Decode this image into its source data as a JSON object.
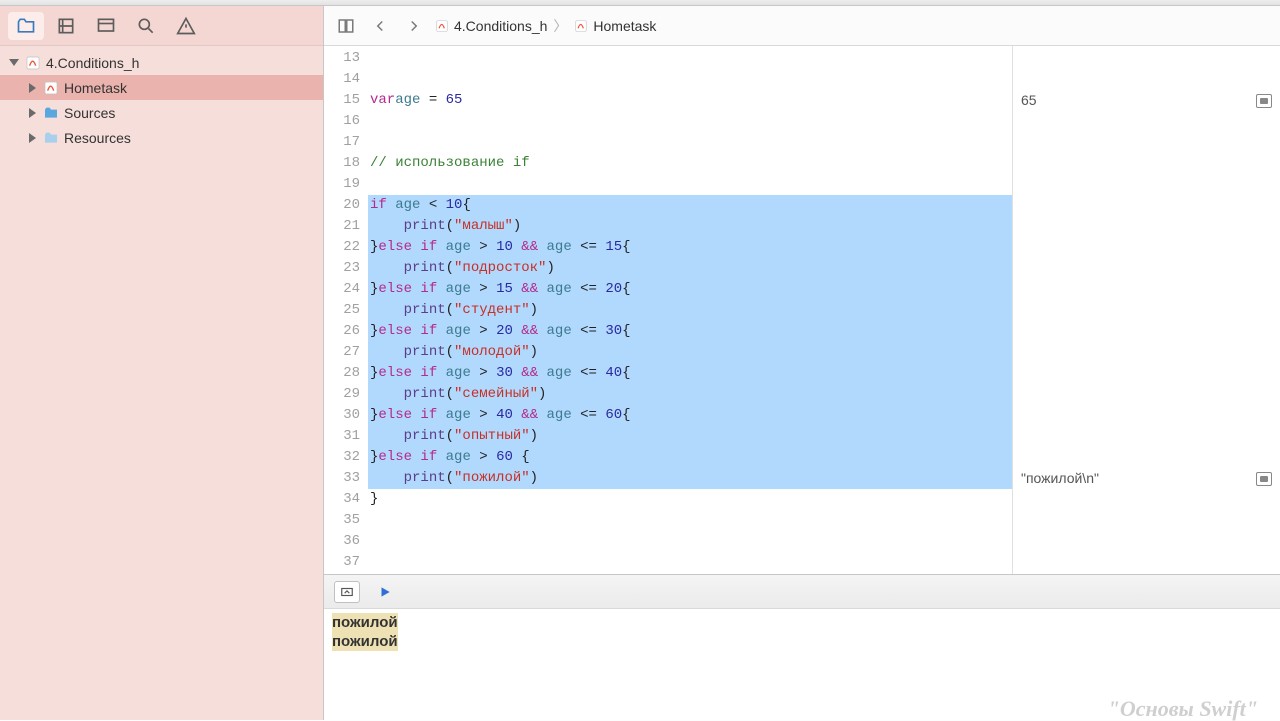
{
  "breadcrumb": {
    "project": "4.Conditions_h",
    "file": "Hometask"
  },
  "sidebar": {
    "root": "4.Conditions_h",
    "items": [
      {
        "label": "Hometask",
        "kind": "swift",
        "selected": true
      },
      {
        "label": "Sources",
        "kind": "folder-blue"
      },
      {
        "label": "Resources",
        "kind": "folder-lblue"
      }
    ]
  },
  "code": {
    "startLine": 13,
    "lines": [
      {
        "n": 13,
        "raw": ""
      },
      {
        "n": 14,
        "raw": ""
      },
      {
        "n": 15,
        "tokens": [
          [
            "kw",
            "var"
          ],
          [
            "",
            ""
          ],
          [
            "ident",
            "age"
          ],
          [
            "",
            " = "
          ],
          [
            "num",
            "65"
          ]
        ]
      },
      {
        "n": 16,
        "raw": ""
      },
      {
        "n": 17,
        "raw": ""
      },
      {
        "n": 18,
        "tokens": [
          [
            "cmt",
            "// использование if"
          ]
        ]
      },
      {
        "n": 19,
        "raw": ""
      },
      {
        "n": 20,
        "sel": true,
        "tokens": [
          [
            "kw",
            "if"
          ],
          [
            "",
            " "
          ],
          [
            "ident",
            "age"
          ],
          [
            "",
            " < "
          ],
          [
            "num",
            "10"
          ],
          [
            "",
            "{"
          ]
        ]
      },
      {
        "n": 21,
        "sel": true,
        "tokens": [
          [
            "",
            "    "
          ],
          [
            "fn",
            "print"
          ],
          [
            "",
            "("
          ],
          [
            "str",
            "\"малыш\""
          ],
          [
            "",
            ")"
          ]
        ]
      },
      {
        "n": 22,
        "sel": true,
        "tokens": [
          [
            "",
            "}"
          ],
          [
            "kw",
            "else"
          ],
          [
            "",
            " "
          ],
          [
            "kw",
            "if"
          ],
          [
            "",
            " "
          ],
          [
            "ident",
            "age"
          ],
          [
            "",
            " > "
          ],
          [
            "num",
            "10"
          ],
          [
            "",
            " "
          ],
          [
            "kw",
            "&&"
          ],
          [
            "",
            " "
          ],
          [
            "ident",
            "age"
          ],
          [
            "",
            " <= "
          ],
          [
            "num",
            "15"
          ],
          [
            "",
            "{"
          ]
        ]
      },
      {
        "n": 23,
        "sel": true,
        "tokens": [
          [
            "",
            "    "
          ],
          [
            "fn",
            "print"
          ],
          [
            "",
            "("
          ],
          [
            "str",
            "\"подросток\""
          ],
          [
            "",
            ")"
          ]
        ]
      },
      {
        "n": 24,
        "sel": true,
        "tokens": [
          [
            "",
            "}"
          ],
          [
            "kw",
            "else"
          ],
          [
            "",
            " "
          ],
          [
            "kw",
            "if"
          ],
          [
            "",
            " "
          ],
          [
            "ident",
            "age"
          ],
          [
            "",
            " > "
          ],
          [
            "num",
            "15"
          ],
          [
            "",
            " "
          ],
          [
            "kw",
            "&&"
          ],
          [
            "",
            " "
          ],
          [
            "ident",
            "age"
          ],
          [
            "",
            " <= "
          ],
          [
            "num",
            "20"
          ],
          [
            "",
            "{"
          ]
        ]
      },
      {
        "n": 25,
        "sel": true,
        "tokens": [
          [
            "",
            "    "
          ],
          [
            "fn",
            "print"
          ],
          [
            "",
            "("
          ],
          [
            "str",
            "\"студент\""
          ],
          [
            "",
            ")"
          ]
        ]
      },
      {
        "n": 26,
        "sel": true,
        "tokens": [
          [
            "",
            "}"
          ],
          [
            "kw",
            "else"
          ],
          [
            "",
            " "
          ],
          [
            "kw",
            "if"
          ],
          [
            "",
            " "
          ],
          [
            "ident",
            "age"
          ],
          [
            "",
            " > "
          ],
          [
            "num",
            "20"
          ],
          [
            "",
            " "
          ],
          [
            "kw",
            "&&"
          ],
          [
            "",
            " "
          ],
          [
            "ident",
            "age"
          ],
          [
            "",
            " <= "
          ],
          [
            "num",
            "30"
          ],
          [
            "",
            "{"
          ]
        ]
      },
      {
        "n": 27,
        "sel": true,
        "tokens": [
          [
            "",
            "    "
          ],
          [
            "fn",
            "print"
          ],
          [
            "",
            "("
          ],
          [
            "str",
            "\"молодой\""
          ],
          [
            "",
            ")"
          ]
        ]
      },
      {
        "n": 28,
        "sel": true,
        "tokens": [
          [
            "",
            "}"
          ],
          [
            "kw",
            "else"
          ],
          [
            "",
            " "
          ],
          [
            "kw",
            "if"
          ],
          [
            "",
            " "
          ],
          [
            "ident",
            "age"
          ],
          [
            "",
            " > "
          ],
          [
            "num",
            "30"
          ],
          [
            "",
            " "
          ],
          [
            "kw",
            "&&"
          ],
          [
            "",
            " "
          ],
          [
            "ident",
            "age"
          ],
          [
            "",
            " <= "
          ],
          [
            "num",
            "40"
          ],
          [
            "",
            "{"
          ]
        ]
      },
      {
        "n": 29,
        "sel": true,
        "tokens": [
          [
            "",
            "    "
          ],
          [
            "fn",
            "print"
          ],
          [
            "",
            "("
          ],
          [
            "str",
            "\"семейный\""
          ],
          [
            "",
            ")"
          ]
        ]
      },
      {
        "n": 30,
        "sel": true,
        "tokens": [
          [
            "",
            "}"
          ],
          [
            "kw",
            "else"
          ],
          [
            "",
            " "
          ],
          [
            "kw",
            "if"
          ],
          [
            "",
            " "
          ],
          [
            "ident",
            "age"
          ],
          [
            "",
            " > "
          ],
          [
            "num",
            "40"
          ],
          [
            "",
            " "
          ],
          [
            "kw",
            "&&"
          ],
          [
            "",
            " "
          ],
          [
            "ident",
            "age"
          ],
          [
            "",
            " <= "
          ],
          [
            "num",
            "60"
          ],
          [
            "",
            "{"
          ]
        ]
      },
      {
        "n": 31,
        "sel": true,
        "tokens": [
          [
            "",
            "    "
          ],
          [
            "fn",
            "print"
          ],
          [
            "",
            "("
          ],
          [
            "str",
            "\"опытный\""
          ],
          [
            "",
            ")"
          ]
        ]
      },
      {
        "n": 32,
        "sel": true,
        "tokens": [
          [
            "",
            "}"
          ],
          [
            "kw",
            "else"
          ],
          [
            "",
            " "
          ],
          [
            "kw",
            "if"
          ],
          [
            "",
            " "
          ],
          [
            "ident",
            "age"
          ],
          [
            "",
            " > "
          ],
          [
            "num",
            "60"
          ],
          [
            "",
            " {"
          ]
        ]
      },
      {
        "n": 33,
        "sel": true,
        "tokens": [
          [
            "",
            "    "
          ],
          [
            "fn",
            "print"
          ],
          [
            "",
            "("
          ],
          [
            "str",
            "\"пожилой\""
          ],
          [
            "",
            ")"
          ]
        ]
      },
      {
        "n": 34,
        "tokens": [
          [
            "",
            "}"
          ]
        ]
      },
      {
        "n": 35,
        "raw": ""
      },
      {
        "n": 36,
        "raw": ""
      },
      {
        "n": 37,
        "raw": ""
      }
    ]
  },
  "results": {
    "r15": "65",
    "r33": "\"пожилой\\n\""
  },
  "console": {
    "lines": [
      "пожилой",
      "пожилой"
    ]
  },
  "watermark": "\"Основы Swift\""
}
